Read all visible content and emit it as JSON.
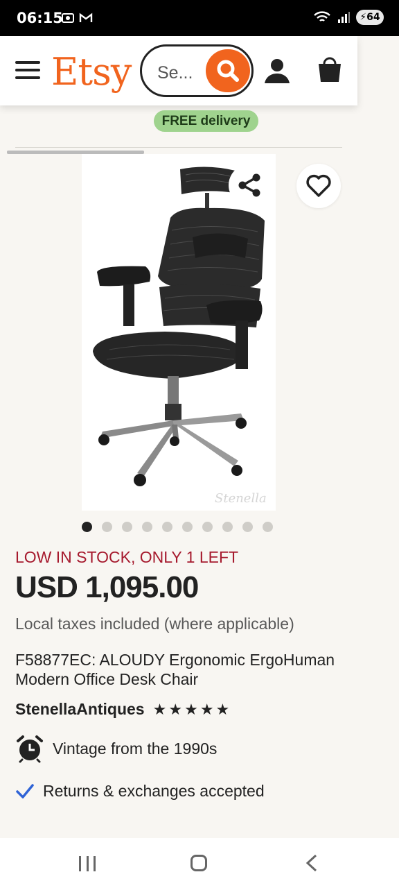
{
  "status_bar": {
    "time": "06:15",
    "battery": "64"
  },
  "header": {
    "logo": "Etsy",
    "search_placeholder": "Se...",
    "brand_color": "#f1641e"
  },
  "banner": {
    "free_delivery": "FREE delivery"
  },
  "carousel": {
    "total": 10,
    "active_index": 0
  },
  "product": {
    "stock": "LOW IN STOCK, ONLY 1 LEFT",
    "price": "USD 1,095.00",
    "taxes": "Local taxes included (where applicable)",
    "title": "F58877EC: ALOUDY Ergonomic ErgoHuman Modern Office Desk Chair",
    "shop_name": "StenellaAntiques",
    "rating_stars": 5,
    "image_watermark": "Stenella"
  },
  "features": {
    "vintage": "Vintage from the 1990s",
    "returns": "Returns & exchanges accepted"
  },
  "icons": {
    "menu": "menu-icon",
    "search": "search-icon",
    "account": "account-icon",
    "bag": "bag-icon",
    "share": "share-icon",
    "favorite": "heart-icon",
    "clock": "alarm-clock-icon",
    "check": "checkmark-icon"
  }
}
